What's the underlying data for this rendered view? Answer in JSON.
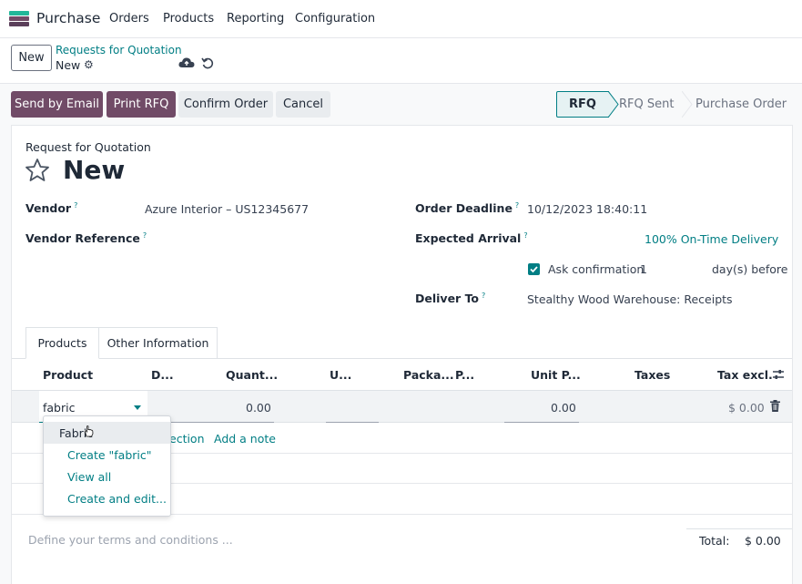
{
  "nav": {
    "app_name": "Purchase",
    "items": [
      "Orders",
      "Products",
      "Reporting",
      "Configuration"
    ]
  },
  "control": {
    "new_label": "New",
    "breadcrumb_parent": "Requests for Quotation",
    "breadcrumb_current": "New"
  },
  "actions": {
    "send_email": "Send by Email",
    "print_rfq": "Print RFQ",
    "confirm": "Confirm Order",
    "cancel": "Cancel"
  },
  "status": {
    "steps": [
      "RFQ",
      "RFQ Sent",
      "Purchase Order"
    ],
    "active": "RFQ"
  },
  "form": {
    "doc_type": "Request for Quotation",
    "title": "New",
    "vendor_label": "Vendor",
    "vendor_value": "Azure Interior – US12345677",
    "vendor_ref_label": "Vendor Reference",
    "order_deadline_label": "Order Deadline",
    "order_deadline_value": "10/12/2023 18:40:11",
    "expected_arrival_label": "Expected Arrival",
    "on_time_delivery": "100% On-Time Delivery",
    "ask_confirmation": "Ask confirmation",
    "ask_confirmation_days": "1",
    "days_before": "day(s) before",
    "deliver_to_label": "Deliver To",
    "deliver_to_value": "Stealthy Wood Warehouse: Receipts",
    "help_mark": "?"
  },
  "tabs": [
    "Products",
    "Other Information"
  ],
  "table": {
    "headers": [
      "Product",
      "D...",
      "Quant...",
      "U...",
      "Packa...",
      "P...",
      "Unit P...",
      "Taxes",
      "Tax excl."
    ],
    "row": {
      "product": "fabric",
      "quantity": "0.00",
      "unit_price": "0.00",
      "subtotal": "$ 0.00"
    },
    "add_section": "ection",
    "add_note": "Add a note"
  },
  "dropdown": {
    "items": [
      "Fabric",
      "Create \"fabric\"",
      "View all",
      "Create and edit..."
    ]
  },
  "footer": {
    "terms_placeholder": "Define your terms and conditions ...",
    "total_label": "Total:",
    "total_value": "$ 0.00"
  },
  "colors": {
    "primary": "#714b67",
    "accent": "#017e84"
  }
}
